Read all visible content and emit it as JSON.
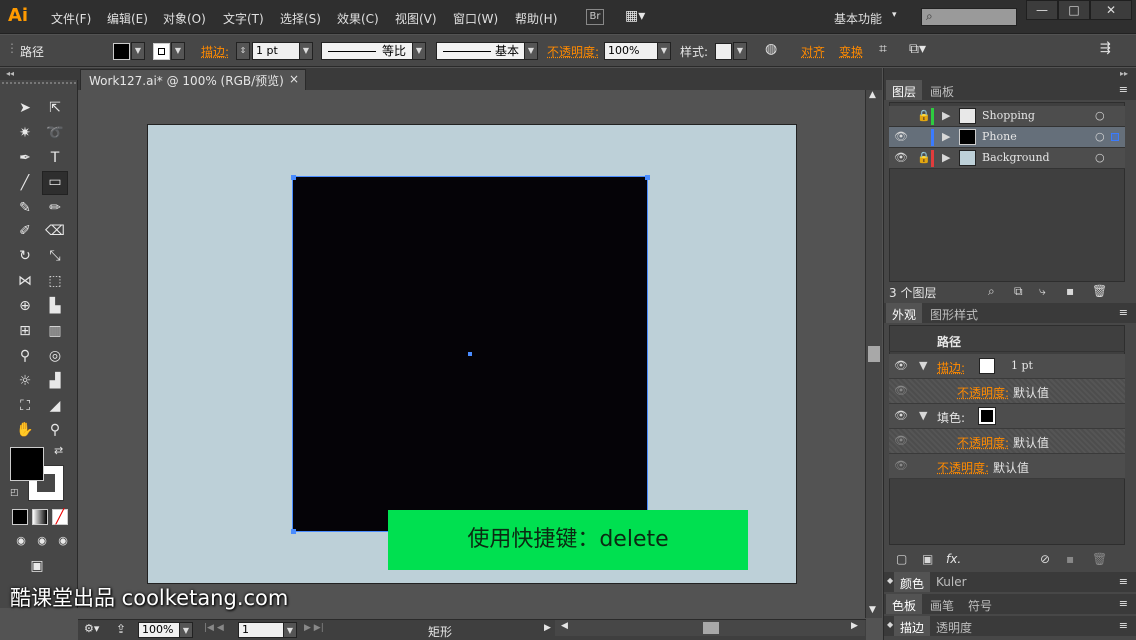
{
  "menubar": {
    "logo": "Ai",
    "items": [
      "文件(F)",
      "编辑(E)",
      "对象(O)",
      "文字(T)",
      "选择(S)",
      "效果(C)",
      "视图(V)",
      "窗口(W)",
      "帮助(H)"
    ],
    "bridge": "Br",
    "workspace": "基本功能",
    "window_buttons": [
      "—",
      "□",
      "✕"
    ]
  },
  "controlbar": {
    "object_type": "路径",
    "stroke_label": "描边:",
    "stroke_weight": "1 pt",
    "profile": "等比",
    "brush": "基本",
    "opacity_label": "不透明度:",
    "opacity_value": "100%",
    "style_label": "样式:",
    "align": "对齐",
    "transform": "变换"
  },
  "document": {
    "tab_title": "Work127.ai* @ 100% (RGB/预览)",
    "close": "×"
  },
  "overlay": {
    "banner": "使用快捷键：delete",
    "watermark": "酷课堂出品 coolketang.com"
  },
  "statusbar": {
    "zoom": "100%",
    "artboard": "1",
    "tool_name": "矩形"
  },
  "layers_panel": {
    "tabs": [
      "图层",
      "画板"
    ],
    "layers": [
      {
        "name": "Shopping",
        "color": "#2ecc40",
        "locked": true,
        "visible": false
      },
      {
        "name": "Phone",
        "color": "#3a7bff",
        "locked": false,
        "visible": true
      },
      {
        "name": "Background",
        "color": "#e03c3c",
        "locked": true,
        "visible": true
      }
    ],
    "count": "3 个图层"
  },
  "appearance_panel": {
    "tabs": [
      "外观",
      "图形样式"
    ],
    "title": "路径",
    "rows": [
      {
        "label": "描边:",
        "value": "1 pt"
      },
      {
        "label": "不透明度:",
        "value": "默认值"
      },
      {
        "label": "填色:",
        "value": ""
      },
      {
        "label": "不透明度:",
        "value": "默认值"
      },
      {
        "label": "不透明度:",
        "value": "默认值"
      }
    ],
    "fx": "fx."
  },
  "collapsed_panels": [
    {
      "tabs": [
        "颜色",
        "Kuler"
      ]
    },
    {
      "tabs": [
        "色板",
        "画笔",
        "符号"
      ]
    },
    {
      "tabs": [
        "描边",
        "透明度"
      ]
    }
  ]
}
